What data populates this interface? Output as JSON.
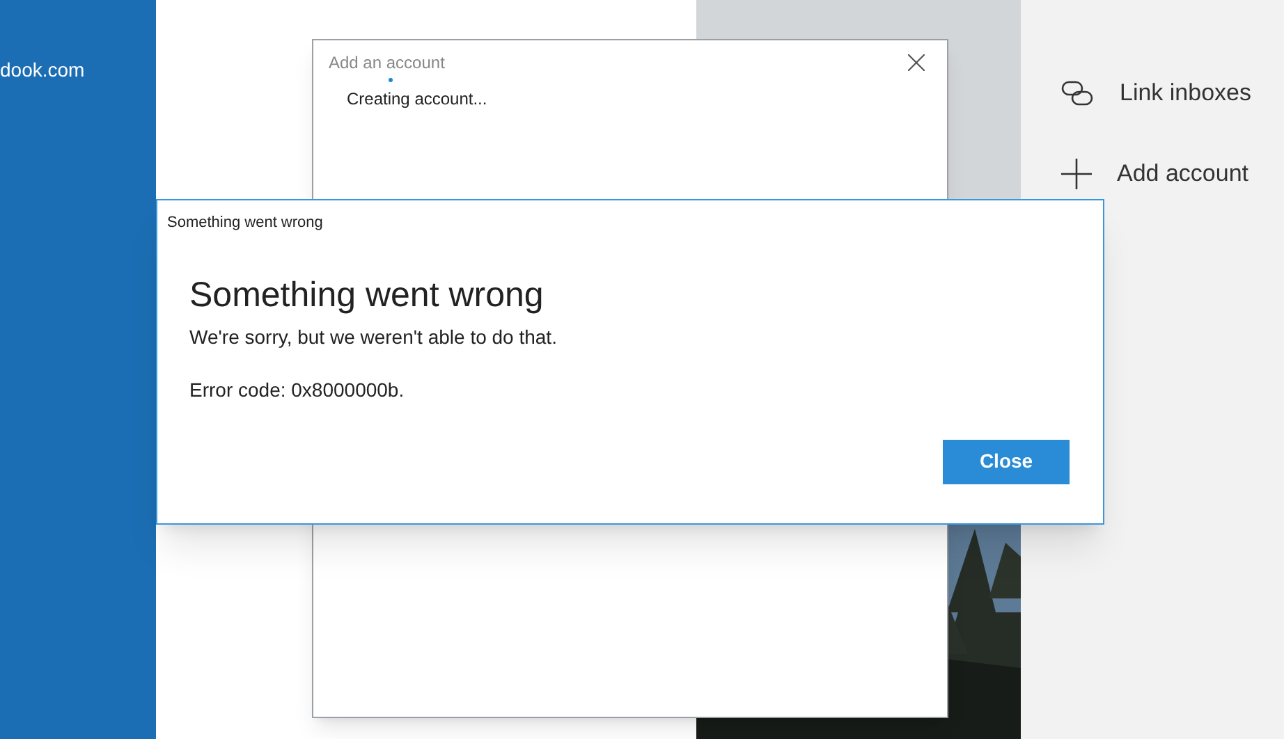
{
  "left_panel": {
    "account_text": "dook.com"
  },
  "right_pane": {
    "items": [
      {
        "kind": "link",
        "label": "Link inboxes"
      },
      {
        "kind": "add",
        "label": "Add account"
      }
    ]
  },
  "add_account_dialog": {
    "title": "Add an account",
    "status": "Creating account..."
  },
  "error_dialog": {
    "window_title": "Something went wrong",
    "heading": "Something went wrong",
    "message": "We're sorry, but we weren't able to do that.",
    "error_code": "Error code: 0x8000000b.",
    "buttons": [
      "Close"
    ]
  }
}
